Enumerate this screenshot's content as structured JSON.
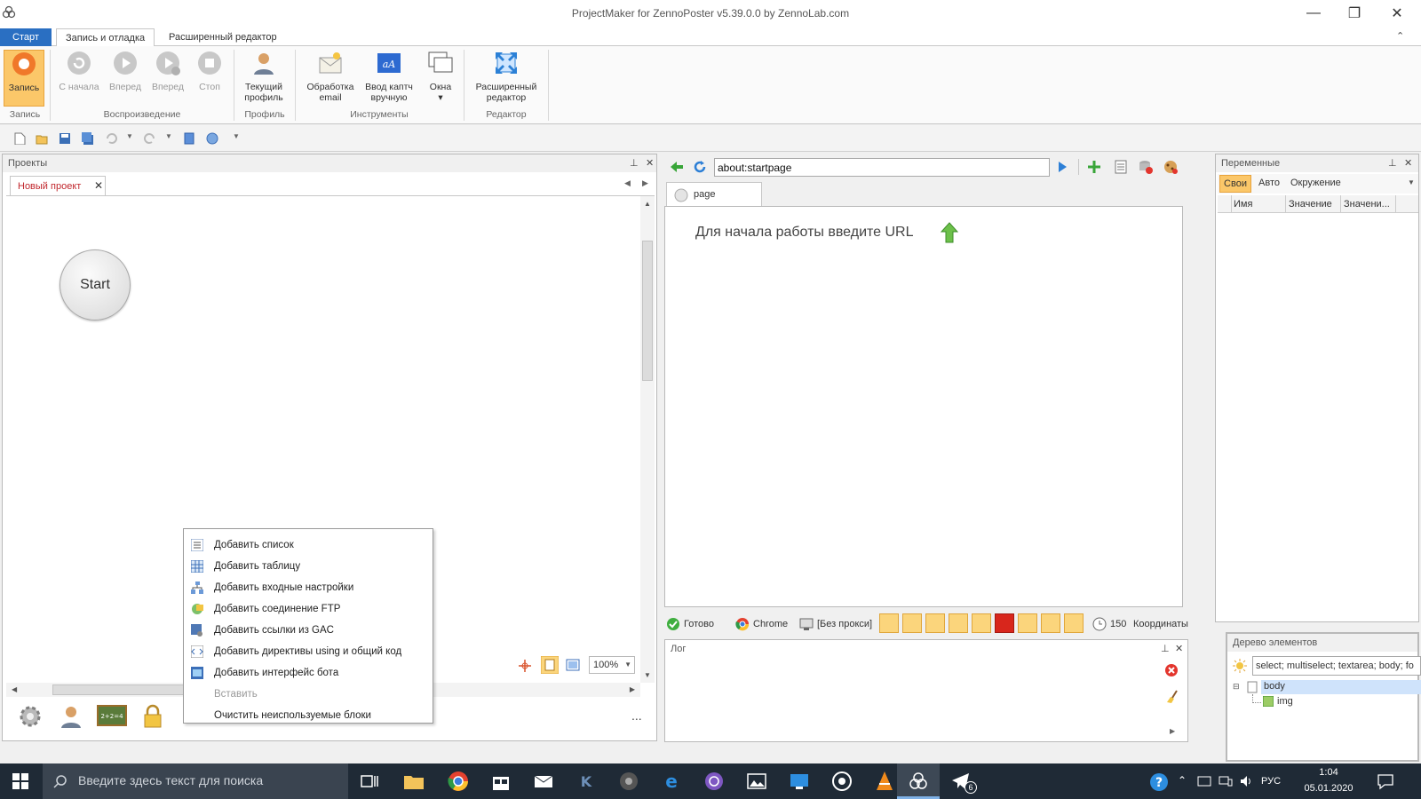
{
  "window": {
    "title": "ProjectMaker for ZennoPoster v5.39.0.0 by ZennoLab.com",
    "minimize": "—",
    "restore": "❐",
    "close": "✕"
  },
  "ribbon_tabs": [
    {
      "label": "Старт"
    },
    {
      "label": "Запись и отладка"
    },
    {
      "label": "Расширенный редактор"
    }
  ],
  "ribbon": {
    "record": {
      "label": "Запись",
      "group": "Запись"
    },
    "playback": {
      "group": "Воспроизведение",
      "buttons": [
        {
          "label": "С начала"
        },
        {
          "label": "Вперед"
        },
        {
          "label": "Вперед"
        },
        {
          "label": "Стоп"
        }
      ]
    },
    "profile": {
      "label1": "Текущий",
      "label2": "профиль",
      "group": "Профиль"
    },
    "tools": {
      "group": "Инструменты",
      "email": {
        "label1": "Обработка",
        "label2": "email"
      },
      "captcha": {
        "label1": "Ввод каптч",
        "label2": "вручную"
      },
      "windows": {
        "label": "Окна",
        "arrow": "▾"
      }
    },
    "editor": {
      "label1": "Расширенный",
      "label2": "редактор",
      "group": "Редактор"
    }
  },
  "projects_panel": {
    "title": "Проекты",
    "tab_label": "Новый проект",
    "tab_close": "✕",
    "start_node": "Start",
    "zoom": "100%",
    "more": "..."
  },
  "context_menu": {
    "items": [
      {
        "label": "Добавить список",
        "enabled": true
      },
      {
        "label": "Добавить таблицу",
        "enabled": true
      },
      {
        "label": "Добавить входные настройки",
        "enabled": true
      },
      {
        "label": "Добавить соединение FTP",
        "enabled": true
      },
      {
        "label": "Добавить ссылки из GAC",
        "enabled": true
      },
      {
        "label": "Добавить директивы using и общий код",
        "enabled": true
      },
      {
        "label": "Добавить интерфейс бота",
        "enabled": true
      },
      {
        "label": "Вставить",
        "enabled": false
      },
      {
        "label": "Очистить неиспользуемые блоки",
        "enabled": true
      }
    ]
  },
  "browser": {
    "url": "about:startpage",
    "tab_label": "page",
    "hint": "Для начала работы введите URL",
    "status": {
      "ready": "Готово",
      "browser": "Chrome",
      "proxy": "[Без прокси]",
      "timer": "150",
      "coords": "Координаты"
    }
  },
  "log_panel": {
    "title": "Лог"
  },
  "variables_panel": {
    "title": "Переменные",
    "tabs": [
      "Свои",
      "Авто",
      "Окружение"
    ],
    "columns": [
      "Имя",
      "Значение",
      "Значени..."
    ]
  },
  "element_tree": {
    "title": "Дерево элементов",
    "filter": "select; multiselect; textarea; body; fo",
    "nodes": [
      "body",
      "img"
    ]
  },
  "taskbar": {
    "search_placeholder": "Введите здесь текст для поиска",
    "lang": "РУС",
    "time": "1:04",
    "date": "05.01.2020",
    "telegram_badge": "6"
  },
  "colors": {
    "accent": "#2a6fc2",
    "record": "#f5a623",
    "taskbar": "#1f2a36",
    "selection": "#cfe3fb"
  }
}
